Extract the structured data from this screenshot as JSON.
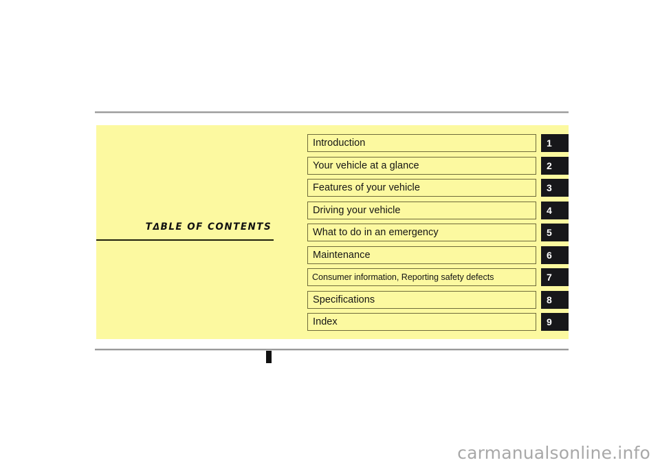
{
  "page": {
    "background_color": "#ffffff",
    "panel_color": "#fcf9a0",
    "rule_color": "#9a9a9a",
    "border_color": "#6e6a3a",
    "number_box_color": "#17171a",
    "text_color": "#141414"
  },
  "heading": {
    "prefix": "T",
    "delta": "Δ",
    "suffix": "BLE  OF  CONTENTS",
    "full_text": "TABLE OF CONTENTS"
  },
  "contents": {
    "items": [
      {
        "label": "Introduction",
        "number": "1",
        "compact": false
      },
      {
        "label": "Your vehicle at a glance",
        "number": "2",
        "compact": false
      },
      {
        "label": "Features of your vehicle",
        "number": "3",
        "compact": false
      },
      {
        "label": "Driving your vehicle",
        "number": "4",
        "compact": false
      },
      {
        "label": "What to do in an emergency",
        "number": "5",
        "compact": false
      },
      {
        "label": "Maintenance",
        "number": "6",
        "compact": false
      },
      {
        "label": "Consumer information, Reporting safety defects",
        "number": "7",
        "compact": true
      },
      {
        "label": "Specifications",
        "number": "8",
        "compact": false
      },
      {
        "label": "Index",
        "number": "9",
        "compact": false
      }
    ]
  },
  "watermark": {
    "text": "carmanualsonline.info"
  }
}
